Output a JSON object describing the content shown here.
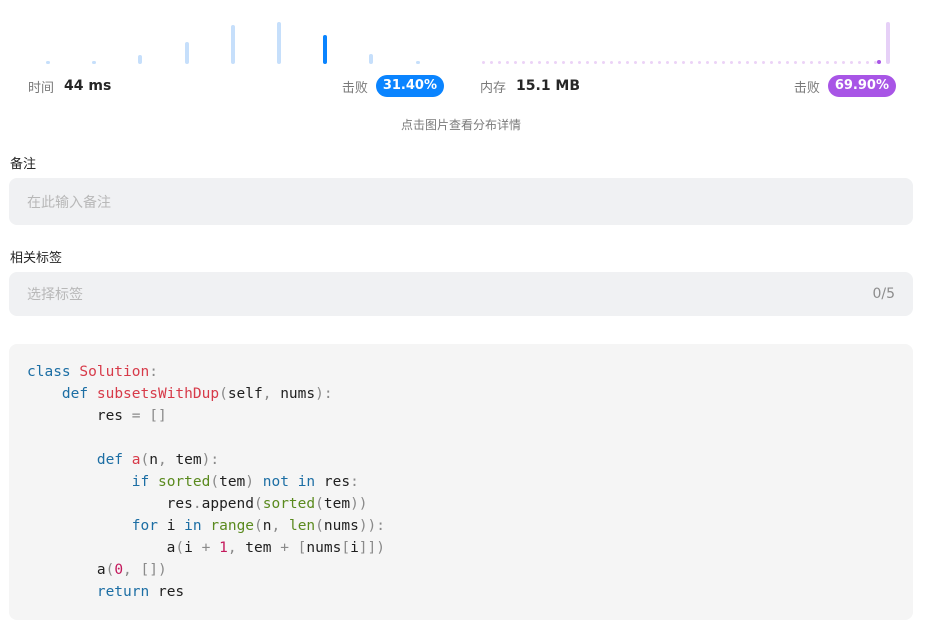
{
  "runtime": {
    "label": "时间",
    "value": "44 ms",
    "beat_label": "击败",
    "beat_percent": "31.40%",
    "accent": "#0a84ff",
    "bars": [
      0.05,
      0.08,
      0.22,
      0.52,
      0.92,
      1.0,
      0.68,
      0.25,
      0.05
    ],
    "highlight_index": 6
  },
  "memory": {
    "label": "内存",
    "value": "15.1 MB",
    "beat_label": "击败",
    "beat_percent": "69.90%",
    "accent": "#a855e6",
    "last_bar": 1.0
  },
  "hint": "点击图片查看分布详情",
  "notes": {
    "label": "备注",
    "placeholder": "在此输入备注"
  },
  "tags": {
    "label": "相关标签",
    "placeholder": "选择标签",
    "counter": "0/5"
  },
  "code": {
    "language": "python"
  }
}
